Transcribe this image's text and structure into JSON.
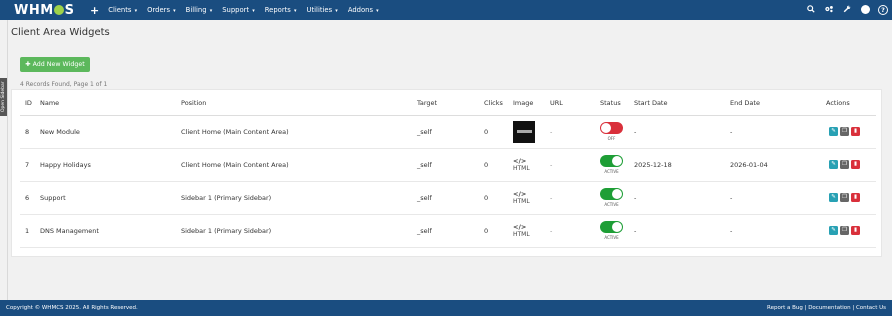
{
  "nav": {
    "logo": "WHMCS",
    "plus": "+",
    "menu": [
      {
        "label": "Clients"
      },
      {
        "label": "Orders"
      },
      {
        "label": "Billing"
      },
      {
        "label": "Support"
      },
      {
        "label": "Reports"
      },
      {
        "label": "Utilities"
      },
      {
        "label": "Addons"
      }
    ],
    "caret": "▾"
  },
  "sidebar_tab": "Open Sidebar",
  "page": {
    "title": "Client Area Widgets",
    "add_button": "Add New Widget",
    "records": "4 Records Found, Page 1 of 1"
  },
  "table": {
    "headers": [
      "ID",
      "Name",
      "Position",
      "Target",
      "Clicks",
      "Image",
      "URL",
      "Status",
      "Start Date",
      "End Date",
      "Actions"
    ],
    "rows": [
      {
        "id": "8",
        "name": "New Module",
        "position": "Client Home (Main Content Area)",
        "target": "_self",
        "clicks": "0",
        "image_type": "thumbnail",
        "html_label": "",
        "url": "-",
        "status": "off",
        "status_label": "OFF",
        "start": "-",
        "end": "-"
      },
      {
        "id": "7",
        "name": "Happy Holidays",
        "position": "Client Home (Main Content Area)",
        "target": "_self",
        "clicks": "0",
        "image_type": "html",
        "html_label": "HTML",
        "url": "-",
        "status": "on",
        "status_label": "ACTIVE",
        "start": "2025-12-18",
        "end": "2026-01-04"
      },
      {
        "id": "6",
        "name": "Support",
        "position": "Sidebar 1 (Primary Sidebar)",
        "target": "_self",
        "clicks": "0",
        "image_type": "html",
        "html_label": "HTML",
        "url": "-",
        "status": "on",
        "status_label": "ACTIVE",
        "start": "-",
        "end": "-"
      },
      {
        "id": "1",
        "name": "DNS Management",
        "position": "Sidebar 1 (Primary Sidebar)",
        "target": "_self",
        "clicks": "0",
        "image_type": "html",
        "html_label": "HTML",
        "url": "-",
        "status": "on",
        "status_label": "ACTIVE",
        "start": "-",
        "end": "-"
      }
    ]
  },
  "footer": {
    "copyright": "Copyright © WHMCS 2025. All Rights Reserved.",
    "links": "Report a Bug | Documentation | Contact Us"
  },
  "colors": {
    "nav_bg": "#1a4d80",
    "add_button": "#5cb85c",
    "toggle_on": "#1e9e36",
    "toggle_off": "#d9303b",
    "edit_button": "#28a1b4",
    "duplicate_button": "#666666",
    "delete_button": "#d9303b"
  },
  "icons": {
    "nav_right": [
      "search-icon",
      "cogs-icon",
      "wrench-icon",
      "user-avatar-icon",
      "help-icon"
    ],
    "actions": [
      "edit-icon",
      "duplicate-icon",
      "delete-icon"
    ]
  }
}
